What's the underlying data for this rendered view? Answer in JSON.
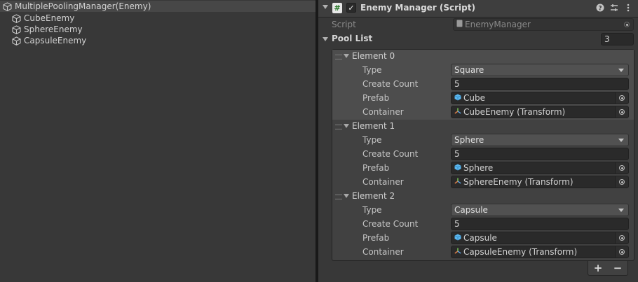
{
  "hierarchy": {
    "root": "MultiplePoolingManager(Enemy)",
    "children": [
      "CubeEnemy",
      "SphereEnemy",
      "CapsuleEnemy"
    ]
  },
  "component": {
    "title": "Enemy Manager (Script)",
    "enabled": true,
    "script_label": "Script",
    "script_value": "EnemyManager"
  },
  "pool": {
    "label": "Pool List",
    "size": "3",
    "elements": [
      {
        "name": "Element 0",
        "type_label": "Type",
        "type": "Square",
        "count_label": "Create Count",
        "count": "5",
        "prefab_label": "Prefab",
        "prefab": "Cube",
        "container_label": "Container",
        "container": "CubeEnemy (Transform)"
      },
      {
        "name": "Element 1",
        "type_label": "Type",
        "type": "Sphere",
        "count_label": "Create Count",
        "count": "5",
        "prefab_label": "Prefab",
        "prefab": "Sphere",
        "container_label": "Container",
        "container": "SphereEnemy (Transform)"
      },
      {
        "name": "Element 2",
        "type_label": "Type",
        "type": "Capsule",
        "count_label": "Create Count",
        "count": "5",
        "prefab_label": "Prefab",
        "prefab": "Capsule",
        "container_label": "Container",
        "container": "CapsuleEnemy (Transform)"
      }
    ]
  },
  "buttons": {
    "add": "+",
    "remove": "−"
  },
  "icons": {
    "gameobject": "cube-outline-icon",
    "prefab": "prefab-cube-icon",
    "transform": "transform-icon",
    "script": "csharp-script-icon"
  },
  "colors": {
    "selected_row": "#474747",
    "prefab_icon": "#5bb8f0"
  }
}
